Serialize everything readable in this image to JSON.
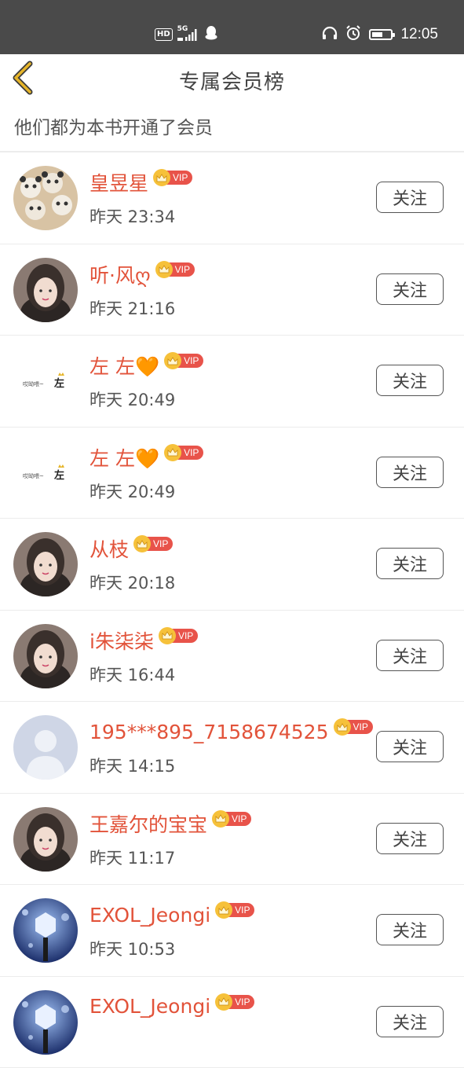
{
  "status_bar": {
    "hd_label": "HD",
    "network_label": "5G",
    "time": "12:05",
    "battery_level": 0.6,
    "icons": [
      "signal-icon",
      "qq-icon",
      "headphones-icon",
      "alarm-icon",
      "battery-icon"
    ]
  },
  "header": {
    "title": "专属会员榜",
    "back_icon": "chevron-left-icon"
  },
  "subtitle": "他们都为本书开通了会员",
  "vip_label": "VIP",
  "follow_label": "关注",
  "colors": {
    "accent_name": "#e2533a",
    "vip_red": "#e8534a",
    "vip_gold": "#f6c13a",
    "back_arrow": "#e6b52a",
    "status_bar": "#4a4a4a"
  },
  "members": [
    {
      "name": "皇昱星",
      "time": "昨天 23:34",
      "avatar": "panda-avatar"
    },
    {
      "name": "听·风ღ",
      "time": "昨天 21:16",
      "avatar": "girl-photo-avatar"
    },
    {
      "name": "左 左🧡",
      "time": "昨天 20:49",
      "avatar": "text-avatar"
    },
    {
      "name": "左 左🧡",
      "time": "昨天 20:49",
      "avatar": "text-avatar"
    },
    {
      "name": "从枝",
      "time": "昨天 20:18",
      "avatar": "girl-photo-avatar"
    },
    {
      "name": "i朱柒柒",
      "time": "昨天 16:44",
      "avatar": "girl-photo-avatar"
    },
    {
      "name": "195***895_7158674525",
      "time": "昨天 14:15",
      "avatar": "default-avatar"
    },
    {
      "name": "王嘉尔的宝宝",
      "time": "昨天 11:17",
      "avatar": "girl-photo-avatar"
    },
    {
      "name": "EXOL_Jeongi",
      "time": "昨天 10:53",
      "avatar": "lightstick-avatar"
    },
    {
      "name": "EXOL_Jeongi",
      "time": "",
      "avatar": "lightstick-avatar"
    }
  ]
}
